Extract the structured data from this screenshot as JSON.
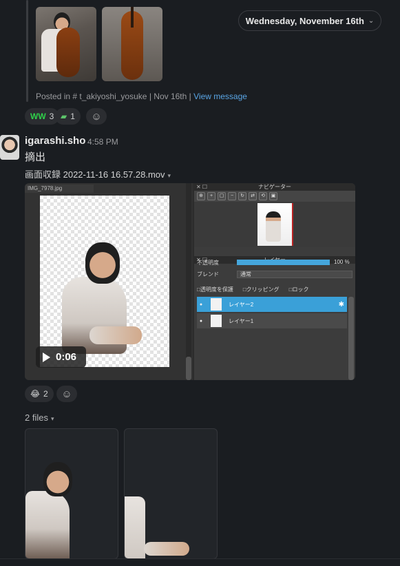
{
  "thread": {
    "posted_in_prefix": "Posted in",
    "channel": "# t_akiyoshi_yosuke",
    "separator": "|",
    "date": "Nov 16th",
    "view_message": "View message"
  },
  "date_pill": {
    "label": "Wednesday, November 16th",
    "chevron": "⌄"
  },
  "reactions_top": [
    {
      "emoji": "WW",
      "count": "3",
      "color": "#2fd14a"
    },
    {
      "emoji": "▰",
      "count": "1",
      "color": "#5cc36a"
    }
  ],
  "message": {
    "username": "igarashi.sho",
    "time": "4:58 PM",
    "text": "摘出",
    "attachment_name": "画面収録 2022-11-16 16.57.28.mov",
    "attachment_caret": "▾"
  },
  "video": {
    "canvas_tab": "IMG_7978.jpg",
    "duration": "0:06",
    "navigator_title": "ナビゲーター",
    "layer_title": "レイヤー",
    "opacity_label": "不透明度",
    "opacity_value": "100 %",
    "opacity_fraction": 1.0,
    "blend_label": "ブレンド",
    "blend_value": "通常",
    "checks": [
      "□透明度を保護",
      "□クリッピング",
      "□ロック"
    ],
    "layers": [
      {
        "name": "レイヤー2",
        "active": true
      },
      {
        "name": "レイヤー1",
        "active": false
      }
    ]
  },
  "reactions_bottom": [
    {
      "emoji": "😂",
      "count": "2"
    }
  ],
  "files": {
    "label": "2 files",
    "caret": "▾"
  }
}
